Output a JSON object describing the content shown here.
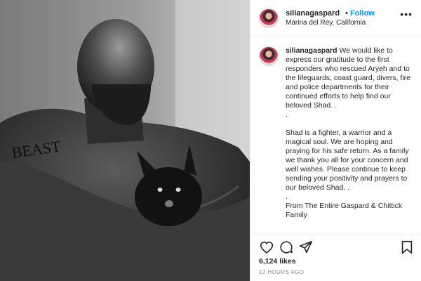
{
  "post": {
    "username": "silianagaspard",
    "separator": "•",
    "follow_label": "Follow",
    "location": "Marina del Rey, California",
    "more_icon": "more-options-icon"
  },
  "caption": {
    "username": "silianagaspard",
    "paragraph_1": "We would like to express our gratitude to the first responders who rescued Aryeh and to the lifeguards, coast guard, divers, fire and police departments for their continued efforts to help find our beloved Shad. .",
    "sep_1": ".",
    "paragraph_2": "Shad is a fighter, a warrior and a magical soul. We are hoping and praying for his safe return. As a family we thank you all for your concern and well wishes. Please continue to keep sending your positivity and prayers to our beloved Shad. .",
    "sep_2": ".",
    "paragraph_3": "From The Entire Gaspard & Chittick Family"
  },
  "photo": {
    "tattoo_text": "BEAST"
  },
  "actions": {
    "icons": [
      "heart-icon",
      "comment-icon",
      "share-icon",
      "bookmark-icon"
    ]
  },
  "likes": "6,124 likes",
  "timestamp": "12 HOURS AGO"
}
